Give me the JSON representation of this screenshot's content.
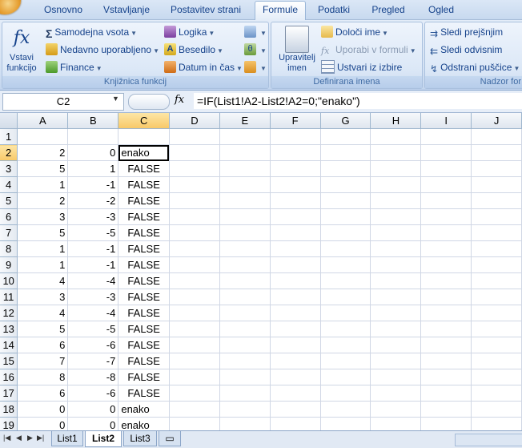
{
  "tabs": [
    {
      "label": "Osnovno",
      "active": false
    },
    {
      "label": "Vstavljanje",
      "active": false
    },
    {
      "label": "Postavitev strani",
      "active": false
    },
    {
      "label": "Formule",
      "active": true
    },
    {
      "label": "Podatki",
      "active": false
    },
    {
      "label": "Pregled",
      "active": false
    },
    {
      "label": "Ogled",
      "active": false
    }
  ],
  "ribbon": {
    "function_library": {
      "label": "Knjižnica funkcij",
      "insert_function_line1": "Vstavi",
      "insert_function_line2": "funkcijo",
      "autosum": "Samodejna vsota",
      "recent": "Nedavno uporabljeno",
      "finance": "Finance",
      "logic": "Logika",
      "text": "Besedilo",
      "datetime": "Datum in čas"
    },
    "defined_names": {
      "label": "Definirana imena",
      "manager_line1": "Upravitelj",
      "manager_line2": "imen",
      "define_name": "Določi ime",
      "use_in_formula": "Uporabi v formuli",
      "create_from_selection": "Ustvari iz izbire"
    },
    "formula_auditing": {
      "label": "Nadzor for",
      "trace_precedents": "Sledi prejšnjim",
      "trace_dependents": "Sledi odvisnim",
      "remove_arrows": "Odstrani puščice"
    }
  },
  "formula_bar": {
    "name_box": "C2",
    "fx": "fx",
    "formula": "=IF(List1!A2-List2!A2=0;\"enako\")"
  },
  "grid": {
    "columns": [
      "A",
      "B",
      "C",
      "D",
      "E",
      "F",
      "G",
      "H",
      "I",
      "J"
    ],
    "selected_column": "C",
    "selected_row": 2,
    "rows": [
      {
        "n": "1",
        "a": "",
        "b": "",
        "c": ""
      },
      {
        "n": "2",
        "a": "2",
        "b": "0",
        "c": "enako"
      },
      {
        "n": "3",
        "a": "5",
        "b": "1",
        "c": "FALSE"
      },
      {
        "n": "4",
        "a": "1",
        "b": "-1",
        "c": "FALSE"
      },
      {
        "n": "5",
        "a": "2",
        "b": "-2",
        "c": "FALSE"
      },
      {
        "n": "6",
        "a": "3",
        "b": "-3",
        "c": "FALSE"
      },
      {
        "n": "7",
        "a": "5",
        "b": "-5",
        "c": "FALSE"
      },
      {
        "n": "8",
        "a": "1",
        "b": "-1",
        "c": "FALSE"
      },
      {
        "n": "9",
        "a": "1",
        "b": "-1",
        "c": "FALSE"
      },
      {
        "n": "10",
        "a": "4",
        "b": "-4",
        "c": "FALSE"
      },
      {
        "n": "11",
        "a": "3",
        "b": "-3",
        "c": "FALSE"
      },
      {
        "n": "12",
        "a": "4",
        "b": "-4",
        "c": "FALSE"
      },
      {
        "n": "13",
        "a": "5",
        "b": "-5",
        "c": "FALSE"
      },
      {
        "n": "14",
        "a": "6",
        "b": "-6",
        "c": "FALSE"
      },
      {
        "n": "15",
        "a": "7",
        "b": "-7",
        "c": "FALSE"
      },
      {
        "n": "16",
        "a": "8",
        "b": "-8",
        "c": "FALSE"
      },
      {
        "n": "17",
        "a": "6",
        "b": "-6",
        "c": "FALSE"
      },
      {
        "n": "18",
        "a": "0",
        "b": "0",
        "c": "enako"
      },
      {
        "n": "19",
        "a": "0",
        "b": "0",
        "c": "enako"
      }
    ]
  },
  "sheets": [
    {
      "label": "List1",
      "active": false
    },
    {
      "label": "List2",
      "active": true
    },
    {
      "label": "List3",
      "active": false
    }
  ],
  "colors": {
    "accent": "#15428b",
    "selected_header": "#f8c968",
    "gridline": "#d0d7e5"
  }
}
